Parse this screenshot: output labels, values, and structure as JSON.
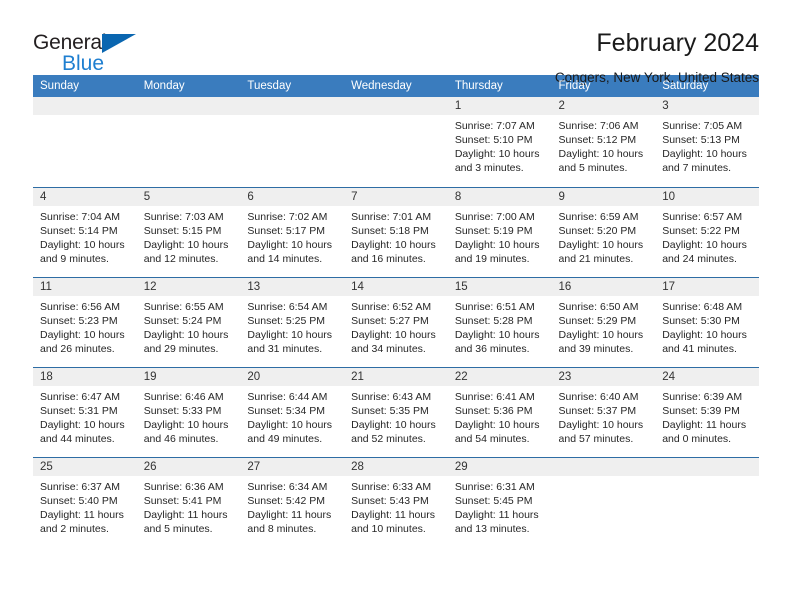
{
  "brand": {
    "name_part1": "General",
    "name_part2": "Blue",
    "logo_icon": "blue-triangle-icon"
  },
  "header": {
    "title": "February 2024",
    "location": "Congers, New York, United States"
  },
  "calendar": {
    "weekday_headers": [
      "Sunday",
      "Monday",
      "Tuesday",
      "Wednesday",
      "Thursday",
      "Friday",
      "Saturday"
    ],
    "labels": {
      "sunrise": "Sunrise:",
      "sunset": "Sunset:",
      "daylight": "Daylight:"
    },
    "colors": {
      "header_blue": "#3a7cbe",
      "row_rule_blue": "#2e6da4",
      "daynum_band": "#efefef",
      "brand_blue": "#1f7fd0",
      "logo_triangle": "#0a66b0"
    },
    "weeks": [
      [
        {
          "day": "",
          "blank": true
        },
        {
          "day": "",
          "blank": true
        },
        {
          "day": "",
          "blank": true
        },
        {
          "day": "",
          "blank": true
        },
        {
          "day": "1",
          "sunrise": "Sunrise: 7:07 AM",
          "sunset": "Sunset: 5:10 PM",
          "daylight": "Daylight: 10 hours and 3 minutes."
        },
        {
          "day": "2",
          "sunrise": "Sunrise: 7:06 AM",
          "sunset": "Sunset: 5:12 PM",
          "daylight": "Daylight: 10 hours and 5 minutes."
        },
        {
          "day": "3",
          "sunrise": "Sunrise: 7:05 AM",
          "sunset": "Sunset: 5:13 PM",
          "daylight": "Daylight: 10 hours and 7 minutes."
        }
      ],
      [
        {
          "day": "4",
          "sunrise": "Sunrise: 7:04 AM",
          "sunset": "Sunset: 5:14 PM",
          "daylight": "Daylight: 10 hours and 9 minutes."
        },
        {
          "day": "5",
          "sunrise": "Sunrise: 7:03 AM",
          "sunset": "Sunset: 5:15 PM",
          "daylight": "Daylight: 10 hours and 12 minutes."
        },
        {
          "day": "6",
          "sunrise": "Sunrise: 7:02 AM",
          "sunset": "Sunset: 5:17 PM",
          "daylight": "Daylight: 10 hours and 14 minutes."
        },
        {
          "day": "7",
          "sunrise": "Sunrise: 7:01 AM",
          "sunset": "Sunset: 5:18 PM",
          "daylight": "Daylight: 10 hours and 16 minutes."
        },
        {
          "day": "8",
          "sunrise": "Sunrise: 7:00 AM",
          "sunset": "Sunset: 5:19 PM",
          "daylight": "Daylight: 10 hours and 19 minutes."
        },
        {
          "day": "9",
          "sunrise": "Sunrise: 6:59 AM",
          "sunset": "Sunset: 5:20 PM",
          "daylight": "Daylight: 10 hours and 21 minutes."
        },
        {
          "day": "10",
          "sunrise": "Sunrise: 6:57 AM",
          "sunset": "Sunset: 5:22 PM",
          "daylight": "Daylight: 10 hours and 24 minutes."
        }
      ],
      [
        {
          "day": "11",
          "sunrise": "Sunrise: 6:56 AM",
          "sunset": "Sunset: 5:23 PM",
          "daylight": "Daylight: 10 hours and 26 minutes."
        },
        {
          "day": "12",
          "sunrise": "Sunrise: 6:55 AM",
          "sunset": "Sunset: 5:24 PM",
          "daylight": "Daylight: 10 hours and 29 minutes."
        },
        {
          "day": "13",
          "sunrise": "Sunrise: 6:54 AM",
          "sunset": "Sunset: 5:25 PM",
          "daylight": "Daylight: 10 hours and 31 minutes."
        },
        {
          "day": "14",
          "sunrise": "Sunrise: 6:52 AM",
          "sunset": "Sunset: 5:27 PM",
          "daylight": "Daylight: 10 hours and 34 minutes."
        },
        {
          "day": "15",
          "sunrise": "Sunrise: 6:51 AM",
          "sunset": "Sunset: 5:28 PM",
          "daylight": "Daylight: 10 hours and 36 minutes."
        },
        {
          "day": "16",
          "sunrise": "Sunrise: 6:50 AM",
          "sunset": "Sunset: 5:29 PM",
          "daylight": "Daylight: 10 hours and 39 minutes."
        },
        {
          "day": "17",
          "sunrise": "Sunrise: 6:48 AM",
          "sunset": "Sunset: 5:30 PM",
          "daylight": "Daylight: 10 hours and 41 minutes."
        }
      ],
      [
        {
          "day": "18",
          "sunrise": "Sunrise: 6:47 AM",
          "sunset": "Sunset: 5:31 PM",
          "daylight": "Daylight: 10 hours and 44 minutes."
        },
        {
          "day": "19",
          "sunrise": "Sunrise: 6:46 AM",
          "sunset": "Sunset: 5:33 PM",
          "daylight": "Daylight: 10 hours and 46 minutes."
        },
        {
          "day": "20",
          "sunrise": "Sunrise: 6:44 AM",
          "sunset": "Sunset: 5:34 PM",
          "daylight": "Daylight: 10 hours and 49 minutes."
        },
        {
          "day": "21",
          "sunrise": "Sunrise: 6:43 AM",
          "sunset": "Sunset: 5:35 PM",
          "daylight": "Daylight: 10 hours and 52 minutes."
        },
        {
          "day": "22",
          "sunrise": "Sunrise: 6:41 AM",
          "sunset": "Sunset: 5:36 PM",
          "daylight": "Daylight: 10 hours and 54 minutes."
        },
        {
          "day": "23",
          "sunrise": "Sunrise: 6:40 AM",
          "sunset": "Sunset: 5:37 PM",
          "daylight": "Daylight: 10 hours and 57 minutes."
        },
        {
          "day": "24",
          "sunrise": "Sunrise: 6:39 AM",
          "sunset": "Sunset: 5:39 PM",
          "daylight": "Daylight: 11 hours and 0 minutes."
        }
      ],
      [
        {
          "day": "25",
          "sunrise": "Sunrise: 6:37 AM",
          "sunset": "Sunset: 5:40 PM",
          "daylight": "Daylight: 11 hours and 2 minutes."
        },
        {
          "day": "26",
          "sunrise": "Sunrise: 6:36 AM",
          "sunset": "Sunset: 5:41 PM",
          "daylight": "Daylight: 11 hours and 5 minutes."
        },
        {
          "day": "27",
          "sunrise": "Sunrise: 6:34 AM",
          "sunset": "Sunset: 5:42 PM",
          "daylight": "Daylight: 11 hours and 8 minutes."
        },
        {
          "day": "28",
          "sunrise": "Sunrise: 6:33 AM",
          "sunset": "Sunset: 5:43 PM",
          "daylight": "Daylight: 11 hours and 10 minutes."
        },
        {
          "day": "29",
          "sunrise": "Sunrise: 6:31 AM",
          "sunset": "Sunset: 5:45 PM",
          "daylight": "Daylight: 11 hours and 13 minutes."
        },
        {
          "day": "",
          "blank": true
        },
        {
          "day": "",
          "blank": true
        }
      ]
    ]
  }
}
